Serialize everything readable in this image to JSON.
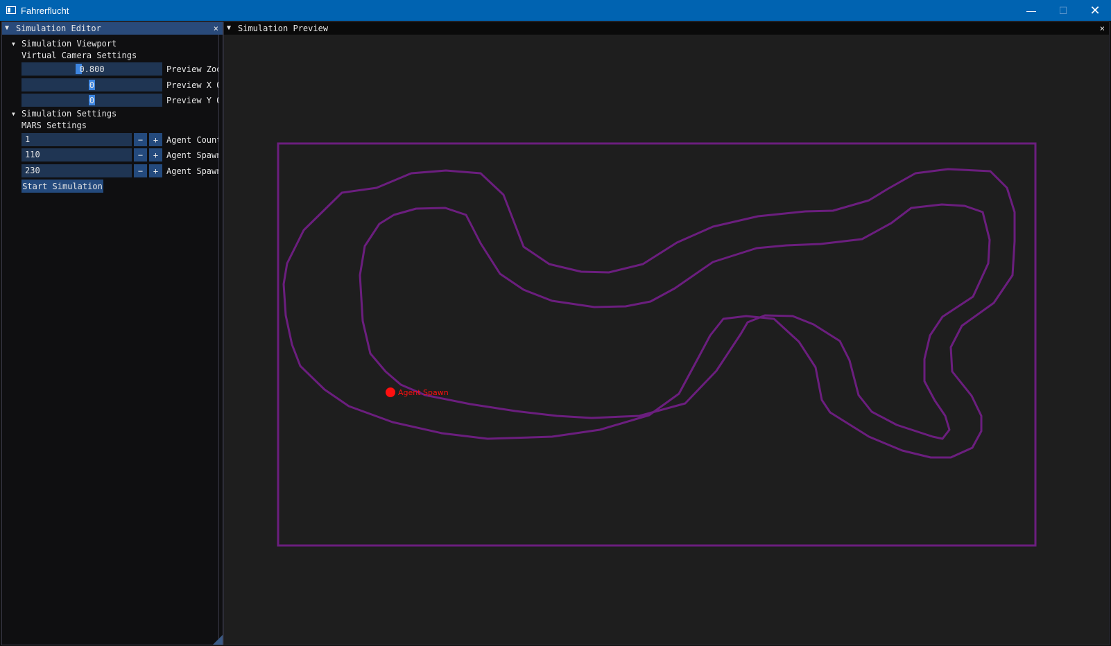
{
  "window": {
    "title": "Fahrerflucht",
    "minimize_glyph": "—",
    "maximize_glyph": "☐",
    "close_glyph": "✕"
  },
  "editor": {
    "title": "Simulation Editor",
    "close_glyph": "×",
    "viewport_section": {
      "header": "Simulation Viewport",
      "subheader": "Virtual Camera Settings",
      "sliders": [
        {
          "value": "0.800",
          "label": "Preview Zoom",
          "fraction": 0.4
        },
        {
          "value": "0",
          "label": "Preview X Offset",
          "fraction": 0.5
        },
        {
          "value": "0",
          "label": "Preview Y Offset",
          "fraction": 0.5
        }
      ]
    },
    "simulation_section": {
      "header": "Simulation Settings",
      "subheader": "MARS Settings",
      "inputs": [
        {
          "value": "1",
          "label": "Agent Count"
        },
        {
          "value": "110",
          "label": "Agent Spawn X"
        },
        {
          "value": "230",
          "label": "Agent Spawn Y"
        }
      ],
      "minus_glyph": "−",
      "plus_glyph": "+",
      "start_button": "Start Simulation"
    }
  },
  "preview": {
    "title": "Simulation Preview",
    "close_glyph": "×",
    "spawn_label": "Agent Spawn",
    "colors": {
      "track": "#6b1e7e",
      "spawn": "#ff1010",
      "background": "#1e1e1e"
    }
  }
}
